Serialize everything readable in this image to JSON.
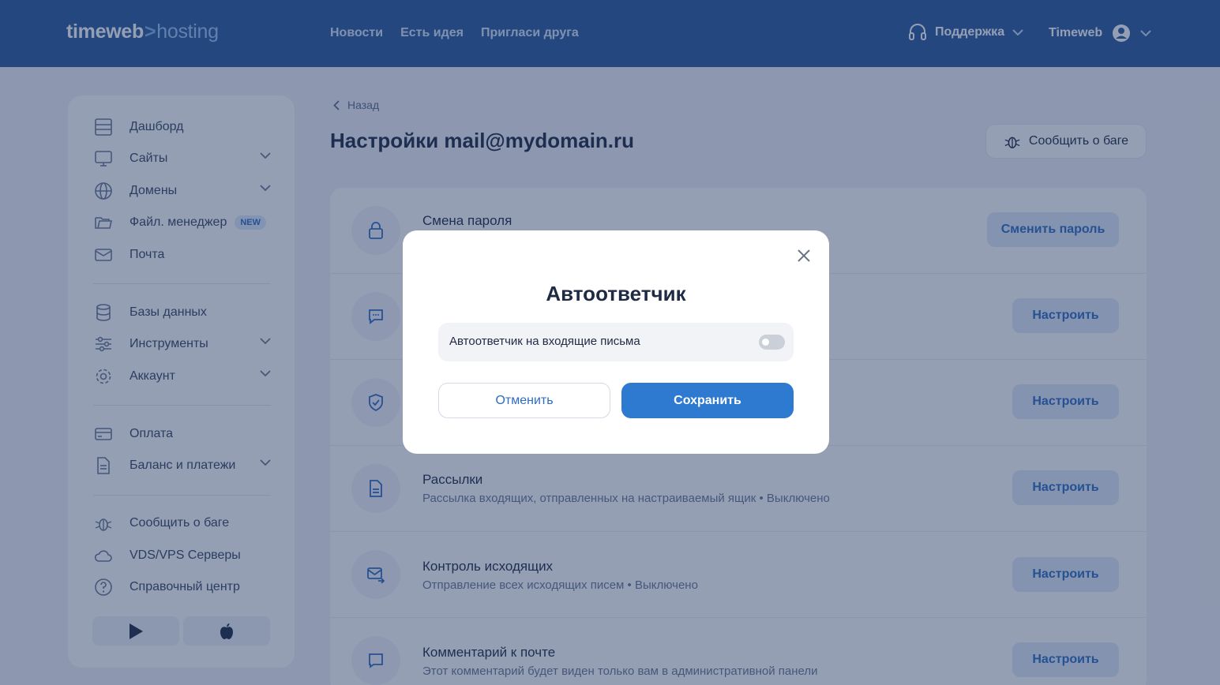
{
  "header": {
    "logo_main": "timeweb",
    "logo_sep": ">",
    "logo_sub": "hosting",
    "nav": [
      "Новости",
      "Есть идея",
      "Пригласи друга"
    ],
    "support_label": "Поддержка",
    "user_label": "Timeweb"
  },
  "sidebar": {
    "items": [
      {
        "label": "Дашборд",
        "icon": "dashboard-icon"
      },
      {
        "label": "Сайты",
        "icon": "monitor-icon"
      },
      {
        "label": "Домены",
        "icon": "globe-icon"
      },
      {
        "label": "Файл. менеджер",
        "icon": "folder-icon",
        "badge": "NEW"
      },
      {
        "label": "Почта",
        "icon": "mail-icon"
      },
      {
        "label": "Базы данных",
        "icon": "database-icon"
      },
      {
        "label": "Инструменты",
        "icon": "sliders-icon"
      },
      {
        "label": "Аккаунт",
        "icon": "gear-icon"
      },
      {
        "label": "Оплата",
        "icon": "card-icon"
      },
      {
        "label": "Баланс и платежи",
        "icon": "document-icon"
      },
      {
        "label": "Сообщить о баге",
        "icon": "bug-icon"
      },
      {
        "label": "VDS/VPS Серверы",
        "icon": "cloud-icon"
      },
      {
        "label": "Справочный центр",
        "icon": "help-icon"
      }
    ]
  },
  "page": {
    "back_label": "Назад",
    "title": "Настройки mail@mydomain.ru",
    "bug_button": "Сообщить о баге"
  },
  "settings": {
    "rows": [
      {
        "title": "Смена пароля",
        "description": "",
        "button": "Сменить пароль"
      },
      {
        "title": "",
        "description": "",
        "button": "Настроить"
      },
      {
        "title": "",
        "description": "",
        "button": "Настроить"
      },
      {
        "title": "Рассылки",
        "description": "Рассылка входящих, отправленных на настраиваемый ящик • Выключено",
        "button": "Настроить"
      },
      {
        "title": "Контроль исходящих",
        "description": "Отправление всех исходящих писем • Выключено",
        "button": "Настроить"
      },
      {
        "title": "Комментарий к почте",
        "description": "Этот комментарий будет виден только вам в административной панели",
        "button": "Настроить"
      }
    ]
  },
  "modal": {
    "title": "Автоответчик",
    "option_label": "Автоответчик на входящие письма",
    "toggle_on": false,
    "cancel_label": "Отменить",
    "save_label": "Сохранить"
  },
  "colors": {
    "header_bg": "#2a5a9c",
    "accent": "#2d7ad0",
    "overlay": "rgba(30,50,95,0.47)"
  }
}
